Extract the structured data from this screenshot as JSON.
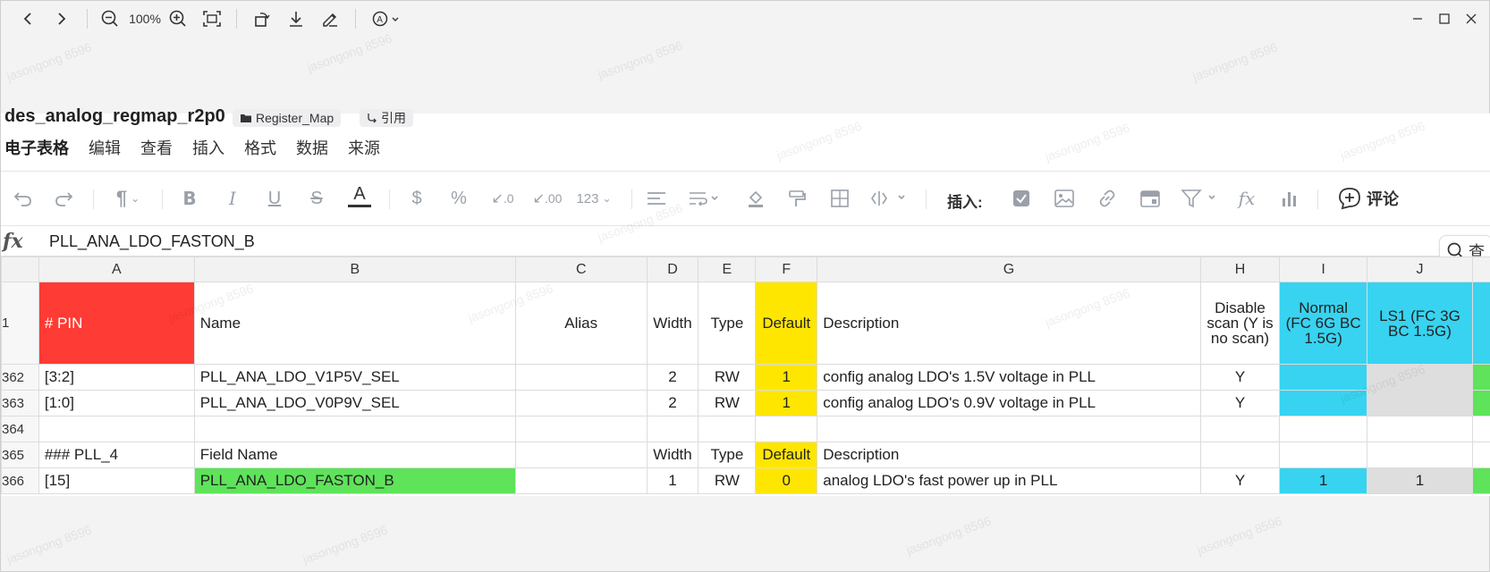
{
  "viewer": {
    "zoom": "100%",
    "icons": [
      "back-arrow-icon",
      "forward-arrow-icon",
      "zoom-out-icon",
      "zoom-in-icon",
      "fit-screen-icon",
      "rotate-icon",
      "download-icon",
      "edit-pen-icon",
      "translate-icon"
    ],
    "window_controls": [
      "minimize-icon",
      "maximize-icon",
      "close-icon"
    ]
  },
  "document": {
    "title": "des_analog_regmap_r2p0",
    "folder_tag": "Register_Map",
    "quote_tag": "引用"
  },
  "menu": [
    "电子表格",
    "编辑",
    "查看",
    "插入",
    "格式",
    "数据",
    "来源"
  ],
  "toolbar": {
    "insert_label": "插入:",
    "comment_label": "评论",
    "number_format": "123",
    "decrease_decimal": ".0",
    "increase_decimal": ".00"
  },
  "formula_bar": {
    "fx": "fx",
    "value": "PLL_ANA_LDO_FASTON_B",
    "search_placeholder": "查"
  },
  "grid": {
    "columns": [
      "A",
      "B",
      "C",
      "D",
      "E",
      "F",
      "G",
      "H",
      "I",
      "J"
    ],
    "header_row": {
      "row": "1",
      "a": "# PIN",
      "b": "Name",
      "c": "Alias",
      "d": "Width",
      "e": "Type",
      "f": "Default",
      "g": "Description",
      "h": "Disable scan (Y is no scan)",
      "i": "Normal (FC 6G BC 1.5G)",
      "j": "LS1 (FC 3G BC 1.5G)"
    },
    "rows": [
      {
        "row": "362",
        "a": "[3:2]",
        "b": "PLL_ANA_LDO_V1P5V_SEL",
        "c": "",
        "d": "2",
        "e": "RW",
        "f": "1",
        "g": "config analog LDO's 1.5V voltage in PLL",
        "h": "Y",
        "i": "",
        "j": ""
      },
      {
        "row": "363",
        "a": "[1:0]",
        "b": "PLL_ANA_LDO_V0P9V_SEL",
        "c": "",
        "d": "2",
        "e": "RW",
        "f": "1",
        "g": "config analog LDO's 0.9V voltage in PLL",
        "h": "Y",
        "i": "",
        "j": ""
      },
      {
        "row": "364",
        "a": "",
        "b": "",
        "c": "",
        "d": "",
        "e": "",
        "f": "",
        "g": "",
        "h": "",
        "i": "",
        "j": ""
      },
      {
        "row": "365",
        "a": "### PLL_4",
        "b": "Field Name",
        "c": "",
        "d": "Width",
        "e": "Type",
        "f": "Default",
        "g": "Description",
        "h": "",
        "i": "",
        "j": ""
      },
      {
        "row": "366",
        "a": "[15]",
        "b": "PLL_ANA_LDO_FASTON_B",
        "c": "",
        "d": "1",
        "e": "RW",
        "f": "0",
        "g": "analog LDO's fast power up in PLL",
        "h": "Y",
        "i": "1",
        "j": "1"
      }
    ]
  },
  "watermark": "jasongong 8596",
  "colors": {
    "pin_header_red": "#ff3b35",
    "default_yellow": "#ffe600",
    "normal_cyan": "#38d3f0",
    "ls1_gray": "#dedede",
    "selected_green": "#5ee35a"
  }
}
